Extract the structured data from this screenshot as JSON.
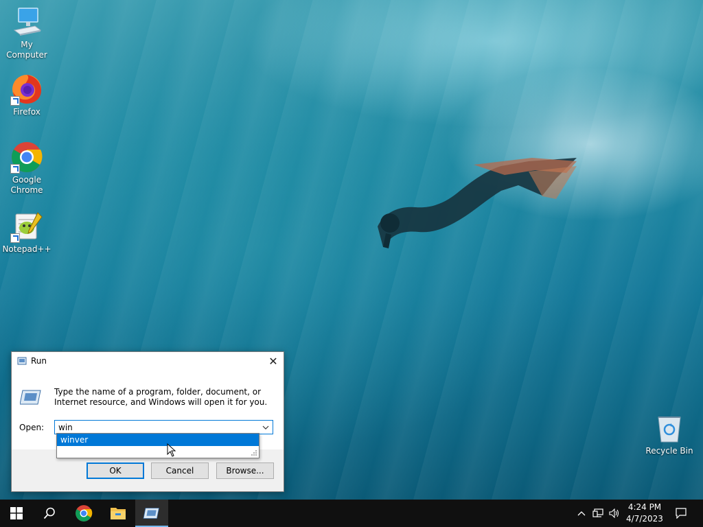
{
  "desktop": {
    "icons": [
      {
        "label": "My Computer",
        "icon": "computer-icon"
      },
      {
        "label": "Firefox",
        "icon": "firefox-icon"
      },
      {
        "label": "Google Chrome",
        "icon": "chrome-icon"
      },
      {
        "label": "Notepad++",
        "icon": "notepadpp-icon"
      },
      {
        "label": "Recycle Bin",
        "icon": "recycle-bin-icon"
      }
    ]
  },
  "run_dialog": {
    "title": "Run",
    "description": "Type the name of a program, folder, document, or Internet resource, and Windows will open it for you.",
    "open_label": "Open:",
    "open_value": "win",
    "autocomplete": [
      "winver"
    ],
    "buttons": {
      "ok": "OK",
      "cancel": "Cancel",
      "browse": "Browse..."
    }
  },
  "taskbar": {
    "items": [
      "start-icon",
      "search-icon",
      "chrome-icon",
      "file-explorer-icon",
      "run-icon"
    ],
    "tray": [
      "chevron-up-icon",
      "network-icon",
      "volume-icon",
      "notification-icon"
    ],
    "time": "4:24 PM",
    "date": "4/7/2023"
  },
  "colors": {
    "accent": "#0078d7",
    "taskbar": "#101010",
    "dialog_bg": "#f0f0f0"
  }
}
